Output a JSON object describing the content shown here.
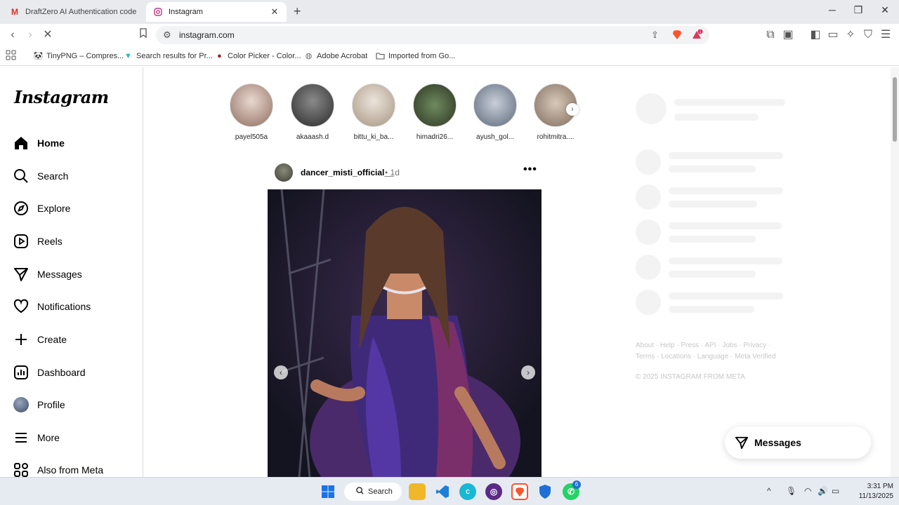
{
  "browser": {
    "tabs": [
      {
        "title": "DraftZero AI Authentication code - a",
        "favicon": "gmail-icon"
      },
      {
        "title": "Instagram",
        "favicon": "instagram-icon"
      }
    ],
    "url": "instagram.com",
    "bookmarks": [
      {
        "label": "TinyPNG – Compres..."
      },
      {
        "label": "Search results for Pr..."
      },
      {
        "label": "Color Picker - Color..."
      },
      {
        "label": "Adobe Acrobat"
      },
      {
        "label": "Imported from Go..."
      }
    ],
    "brave_badge": "1"
  },
  "instagram": {
    "logo": "Instagram",
    "nav": [
      {
        "label": "Home",
        "icon": "home-icon"
      },
      {
        "label": "Search",
        "icon": "search-icon"
      },
      {
        "label": "Explore",
        "icon": "compass-icon"
      },
      {
        "label": "Reels",
        "icon": "reels-icon"
      },
      {
        "label": "Messages",
        "icon": "send-icon"
      },
      {
        "label": "Notifications",
        "icon": "heart-icon"
      },
      {
        "label": "Create",
        "icon": "plus-icon"
      },
      {
        "label": "Dashboard",
        "icon": "dashboard-icon"
      },
      {
        "label": "Profile",
        "icon": "avatar"
      },
      {
        "label": "More",
        "icon": "menu-icon"
      },
      {
        "label": "Also from Meta",
        "icon": "meta-apps-icon"
      }
    ],
    "stories": [
      {
        "name": "payel505a"
      },
      {
        "name": "akaaash.d"
      },
      {
        "name": "bittu_ki_ba..."
      },
      {
        "name": "himadri26..."
      },
      {
        "name": "ayush_gol..."
      },
      {
        "name": "rohitmitra...."
      }
    ],
    "post": {
      "username": "dancer_misti_official__",
      "time": "• 1d",
      "more": "•••"
    },
    "footer_links": "About · Help · Press · API · Jobs · Privacy · Terms · Locations · Language · Meta Verified",
    "copyright": "© 2025 INSTAGRAM FROM META",
    "messages_button": "Messages"
  },
  "taskbar": {
    "search_label": "Search",
    "whatsapp_badge": "6",
    "time": "3:31 PM",
    "date": "11/13/2025"
  }
}
